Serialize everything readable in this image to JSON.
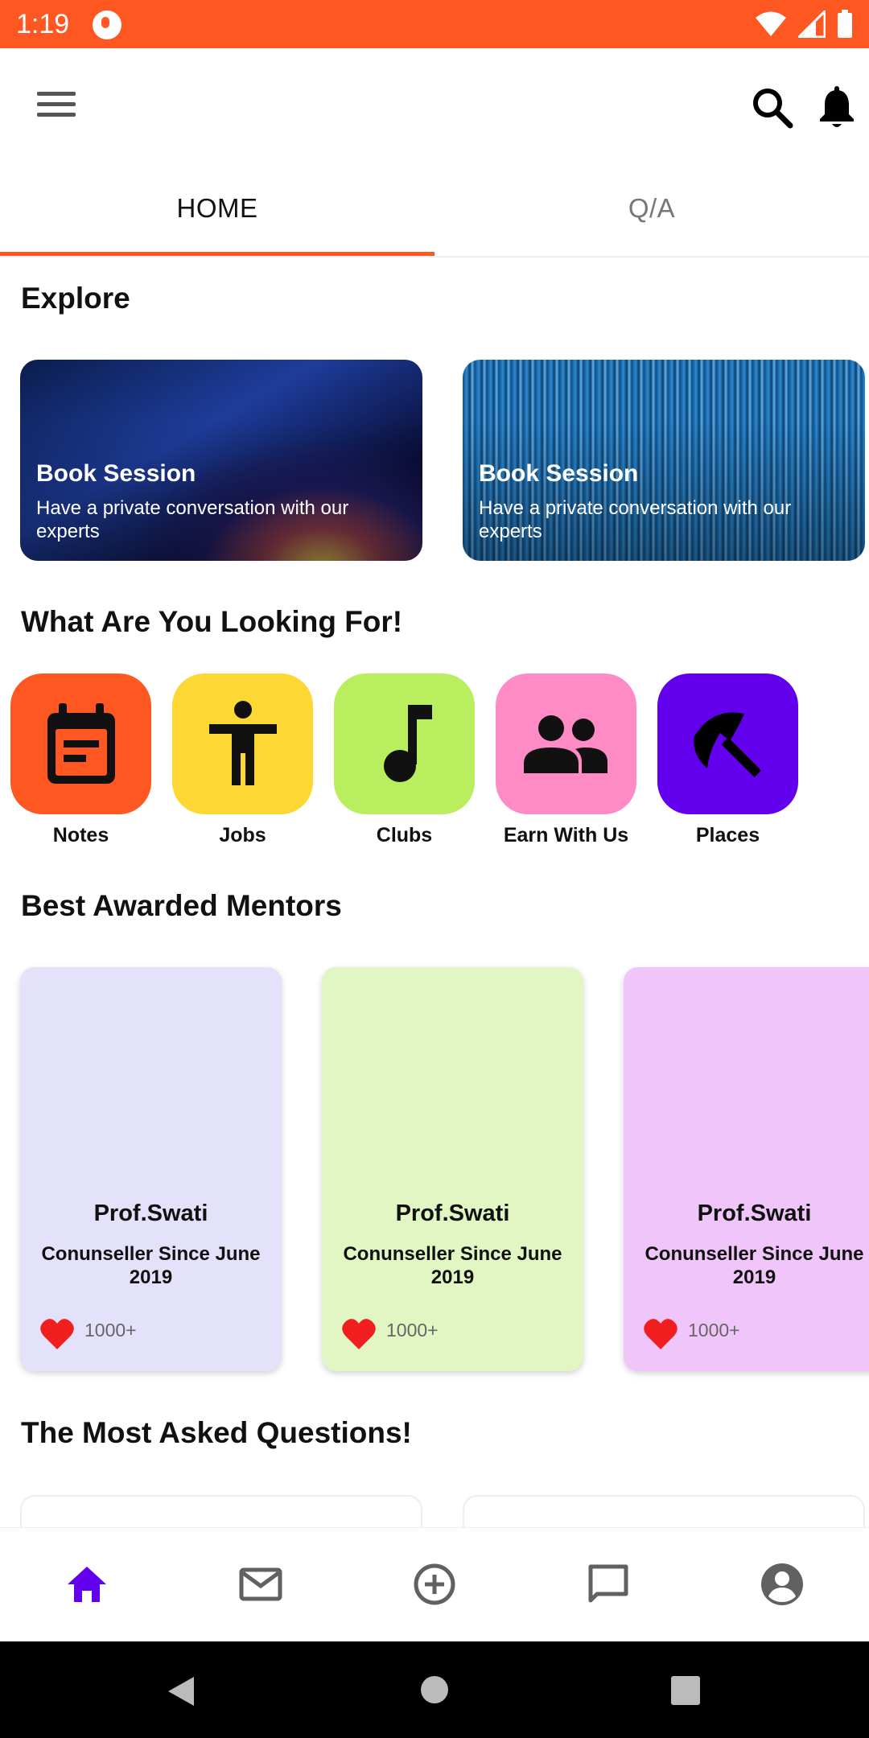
{
  "status_bar": {
    "time": "1:19",
    "wifi_icon": "wifi-icon",
    "signal_icon": "signal-icon",
    "battery_icon": "battery-icon"
  },
  "app_bar": {
    "menu_icon": "menu-icon",
    "search_icon": "search-icon",
    "bell_icon": "bell-icon"
  },
  "tabs": [
    {
      "label": "HOME",
      "active": true
    },
    {
      "label": "Q/A",
      "active": false
    }
  ],
  "explore": {
    "title": "Explore",
    "cards": [
      {
        "title": "Book Session",
        "description": "Have a private conversation with our experts"
      },
      {
        "title": "Book Session",
        "description": "Have a private conversation with our experts"
      }
    ]
  },
  "looking_for": {
    "title": "What Are You Looking For!",
    "items": [
      {
        "label": "Notes",
        "icon": "calendar-notes-icon",
        "color": "#FF5722"
      },
      {
        "label": "Jobs",
        "icon": "person-accessibility-icon",
        "color": "#FDD835"
      },
      {
        "label": "Clubs",
        "icon": "music-note-icon",
        "color": "#B9EF5E"
      },
      {
        "label": "Earn With Us",
        "icon": "people-icon",
        "color": "#FF8BC6"
      },
      {
        "label": "Places",
        "icon": "beach-umbrella-icon",
        "color": "#6200EE"
      }
    ]
  },
  "mentors": {
    "title": "Best Awarded Mentors",
    "items": [
      {
        "name": "Prof.Swati",
        "since": "Conunseller Since June 2019",
        "likes": "1000+",
        "color": "#E4E1FB"
      },
      {
        "name": "Prof.Swati",
        "since": "Conunseller Since June 2019",
        "likes": "1000+",
        "color": "#E1F6C3"
      },
      {
        "name": "Prof.Swati",
        "since": "Conunseller Since June 2019",
        "likes": "1000+",
        "color": "#F0C6FA"
      }
    ]
  },
  "questions": {
    "title": "The Most Asked Questions!"
  },
  "bottom_nav": [
    {
      "name": "home",
      "icon": "home-icon",
      "active": true
    },
    {
      "name": "mail",
      "icon": "mail-icon",
      "active": false
    },
    {
      "name": "add",
      "icon": "add-circle-icon",
      "active": false
    },
    {
      "name": "chat",
      "icon": "chat-icon",
      "active": false
    },
    {
      "name": "profile",
      "icon": "account-icon",
      "active": false
    }
  ],
  "colors": {
    "accent": "#FF5722",
    "nav_active": "#6200EE",
    "nav_inactive": "#616161"
  }
}
